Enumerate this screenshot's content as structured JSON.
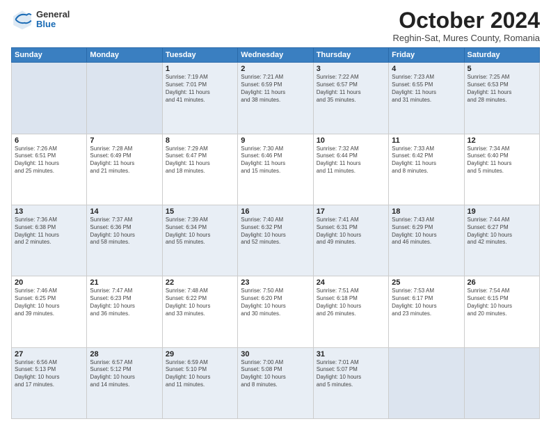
{
  "logo": {
    "general": "General",
    "blue": "Blue"
  },
  "header": {
    "month": "October 2024",
    "location": "Reghin-Sat, Mures County, Romania"
  },
  "weekdays": [
    "Sunday",
    "Monday",
    "Tuesday",
    "Wednesday",
    "Thursday",
    "Friday",
    "Saturday"
  ],
  "weeks": [
    [
      {
        "day": "",
        "info": ""
      },
      {
        "day": "",
        "info": ""
      },
      {
        "day": "1",
        "info": "Sunrise: 7:19 AM\nSunset: 7:01 PM\nDaylight: 11 hours\nand 41 minutes."
      },
      {
        "day": "2",
        "info": "Sunrise: 7:21 AM\nSunset: 6:59 PM\nDaylight: 11 hours\nand 38 minutes."
      },
      {
        "day": "3",
        "info": "Sunrise: 7:22 AM\nSunset: 6:57 PM\nDaylight: 11 hours\nand 35 minutes."
      },
      {
        "day": "4",
        "info": "Sunrise: 7:23 AM\nSunset: 6:55 PM\nDaylight: 11 hours\nand 31 minutes."
      },
      {
        "day": "5",
        "info": "Sunrise: 7:25 AM\nSunset: 6:53 PM\nDaylight: 11 hours\nand 28 minutes."
      }
    ],
    [
      {
        "day": "6",
        "info": "Sunrise: 7:26 AM\nSunset: 6:51 PM\nDaylight: 11 hours\nand 25 minutes."
      },
      {
        "day": "7",
        "info": "Sunrise: 7:28 AM\nSunset: 6:49 PM\nDaylight: 11 hours\nand 21 minutes."
      },
      {
        "day": "8",
        "info": "Sunrise: 7:29 AM\nSunset: 6:47 PM\nDaylight: 11 hours\nand 18 minutes."
      },
      {
        "day": "9",
        "info": "Sunrise: 7:30 AM\nSunset: 6:46 PM\nDaylight: 11 hours\nand 15 minutes."
      },
      {
        "day": "10",
        "info": "Sunrise: 7:32 AM\nSunset: 6:44 PM\nDaylight: 11 hours\nand 11 minutes."
      },
      {
        "day": "11",
        "info": "Sunrise: 7:33 AM\nSunset: 6:42 PM\nDaylight: 11 hours\nand 8 minutes."
      },
      {
        "day": "12",
        "info": "Sunrise: 7:34 AM\nSunset: 6:40 PM\nDaylight: 11 hours\nand 5 minutes."
      }
    ],
    [
      {
        "day": "13",
        "info": "Sunrise: 7:36 AM\nSunset: 6:38 PM\nDaylight: 11 hours\nand 2 minutes."
      },
      {
        "day": "14",
        "info": "Sunrise: 7:37 AM\nSunset: 6:36 PM\nDaylight: 10 hours\nand 58 minutes."
      },
      {
        "day": "15",
        "info": "Sunrise: 7:39 AM\nSunset: 6:34 PM\nDaylight: 10 hours\nand 55 minutes."
      },
      {
        "day": "16",
        "info": "Sunrise: 7:40 AM\nSunset: 6:32 PM\nDaylight: 10 hours\nand 52 minutes."
      },
      {
        "day": "17",
        "info": "Sunrise: 7:41 AM\nSunset: 6:31 PM\nDaylight: 10 hours\nand 49 minutes."
      },
      {
        "day": "18",
        "info": "Sunrise: 7:43 AM\nSunset: 6:29 PM\nDaylight: 10 hours\nand 46 minutes."
      },
      {
        "day": "19",
        "info": "Sunrise: 7:44 AM\nSunset: 6:27 PM\nDaylight: 10 hours\nand 42 minutes."
      }
    ],
    [
      {
        "day": "20",
        "info": "Sunrise: 7:46 AM\nSunset: 6:25 PM\nDaylight: 10 hours\nand 39 minutes."
      },
      {
        "day": "21",
        "info": "Sunrise: 7:47 AM\nSunset: 6:23 PM\nDaylight: 10 hours\nand 36 minutes."
      },
      {
        "day": "22",
        "info": "Sunrise: 7:48 AM\nSunset: 6:22 PM\nDaylight: 10 hours\nand 33 minutes."
      },
      {
        "day": "23",
        "info": "Sunrise: 7:50 AM\nSunset: 6:20 PM\nDaylight: 10 hours\nand 30 minutes."
      },
      {
        "day": "24",
        "info": "Sunrise: 7:51 AM\nSunset: 6:18 PM\nDaylight: 10 hours\nand 26 minutes."
      },
      {
        "day": "25",
        "info": "Sunrise: 7:53 AM\nSunset: 6:17 PM\nDaylight: 10 hours\nand 23 minutes."
      },
      {
        "day": "26",
        "info": "Sunrise: 7:54 AM\nSunset: 6:15 PM\nDaylight: 10 hours\nand 20 minutes."
      }
    ],
    [
      {
        "day": "27",
        "info": "Sunrise: 6:56 AM\nSunset: 5:13 PM\nDaylight: 10 hours\nand 17 minutes."
      },
      {
        "day": "28",
        "info": "Sunrise: 6:57 AM\nSunset: 5:12 PM\nDaylight: 10 hours\nand 14 minutes."
      },
      {
        "day": "29",
        "info": "Sunrise: 6:59 AM\nSunset: 5:10 PM\nDaylight: 10 hours\nand 11 minutes."
      },
      {
        "day": "30",
        "info": "Sunrise: 7:00 AM\nSunset: 5:08 PM\nDaylight: 10 hours\nand 8 minutes."
      },
      {
        "day": "31",
        "info": "Sunrise: 7:01 AM\nSunset: 5:07 PM\nDaylight: 10 hours\nand 5 minutes."
      },
      {
        "day": "",
        "info": ""
      },
      {
        "day": "",
        "info": ""
      }
    ]
  ]
}
